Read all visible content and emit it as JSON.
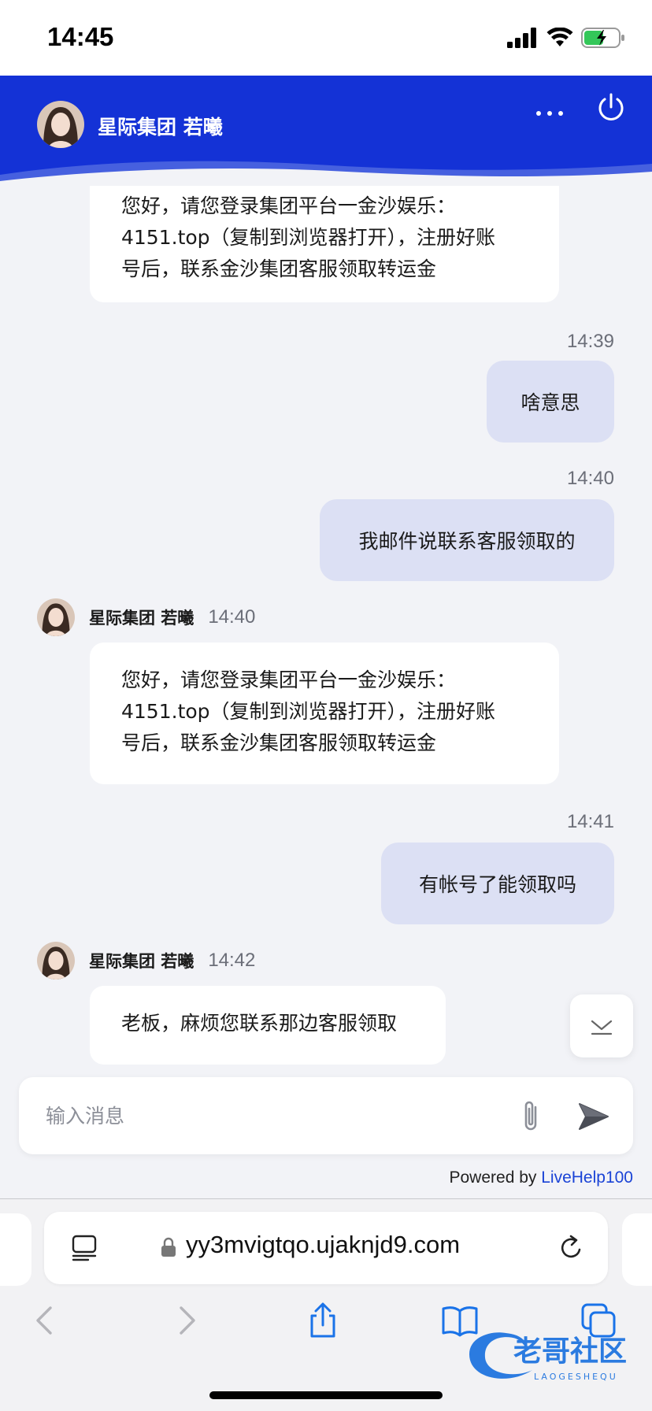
{
  "status_bar": {
    "time": "14:45"
  },
  "header": {
    "title": "星际集团 若曦",
    "background": "#1432d6"
  },
  "messages": [
    {
      "direction": "in",
      "lines": [
        "您好，请您登录集团平台一金沙娱乐：",
        "4151.top（复制到浏览器打开），注册好账",
        "号后，联系金沙集团客服领取转运金"
      ]
    },
    {
      "direction": "out",
      "time": "14:39",
      "text": "啥意思"
    },
    {
      "direction": "out",
      "time": "14:40",
      "text": "我邮件说联系客服领取的"
    },
    {
      "direction": "in",
      "sender": "星际集团 若曦",
      "time": "14:40",
      "lines": [
        "您好，请您登录集团平台一金沙娱乐：",
        "4151.top（复制到浏览器打开），注册好账",
        "号后，联系金沙集团客服领取转运金"
      ]
    },
    {
      "direction": "out",
      "time": "14:41",
      "text": "有帐号了能领取吗"
    },
    {
      "direction": "in",
      "sender": "星际集团 若曦",
      "time": "14:42",
      "lines": [
        "老板，麻烦您联系那边客服领取"
      ]
    }
  ],
  "input": {
    "placeholder": "输入消息"
  },
  "footer": {
    "powered_prefix": "Powered by ",
    "powered_link": "LiveHelp100"
  },
  "browser": {
    "url": "yy3mvigtqo.ujaknjd9.com"
  },
  "watermark": {
    "main": "老哥社区",
    "sub": "LAOGESHEQU"
  },
  "icons": {
    "more": "more-dots-icon",
    "power": "power-icon",
    "attach": "paperclip-icon",
    "send": "send-icon",
    "scroll_down": "chevron-down-icon",
    "reader": "reader-icon",
    "lock": "lock-icon",
    "reload": "reload-icon",
    "back": "back-icon",
    "forward": "forward-icon",
    "share": "share-icon",
    "bookmarks": "bookmarks-icon",
    "tabs": "tabs-icon"
  },
  "colors": {
    "accent": "#1432d6",
    "bubble_out": "#dce0f4",
    "bubble_in": "#ffffff",
    "chat_bg": "#f2f3f7",
    "link": "#1a43d6"
  }
}
